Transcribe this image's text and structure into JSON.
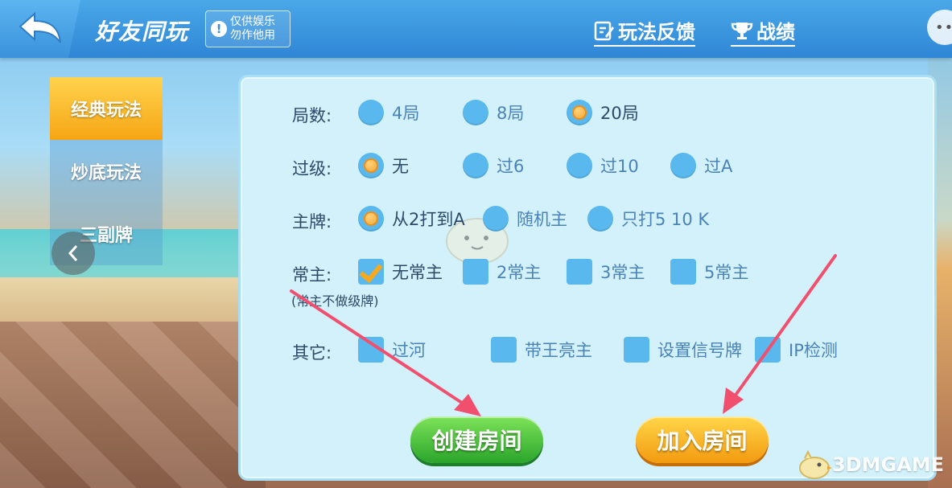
{
  "header": {
    "title": "好友同玩",
    "notice": [
      "仅供娱乐",
      "勿作他用"
    ],
    "links": [
      {
        "label": "玩法反馈"
      },
      {
        "label": "战绩"
      }
    ],
    "more": "••"
  },
  "tabs": [
    {
      "label": "经典玩法",
      "active": true
    },
    {
      "label": "炒底玩法",
      "active": false
    },
    {
      "label": "三副牌",
      "active": false
    }
  ],
  "rules": {
    "rounds": {
      "label": "局数:",
      "options": [
        "4局",
        "8局",
        "20局"
      ],
      "selected": "20局"
    },
    "skip_level": {
      "label": "过级:",
      "options": [
        "无",
        "过6",
        "过10",
        "过A"
      ],
      "selected": "无"
    },
    "trump": {
      "label": "主牌:",
      "options": [
        "从2打到A",
        "随机主",
        "只打5 10 K"
      ],
      "selected": "从2打到A"
    },
    "constant_trump": {
      "label": "常主:",
      "options": [
        "无常主",
        "2常主",
        "3常主",
        "5常主"
      ],
      "selected": "无常主",
      "note": "(常主不做级牌)"
    },
    "other": {
      "label": "其它:",
      "options": [
        "过河",
        "带王亮主",
        "设置信号牌",
        "IP检测"
      ],
      "checked": []
    }
  },
  "actions": {
    "create": "创建房间",
    "join": "加入房间"
  },
  "watermark": "3DMGAME",
  "colors": {
    "accent_orange": "#f6a514",
    "create_green": "#2aa52a",
    "option_blue": "#59b8ee",
    "arrow_red": "#f0506e"
  }
}
